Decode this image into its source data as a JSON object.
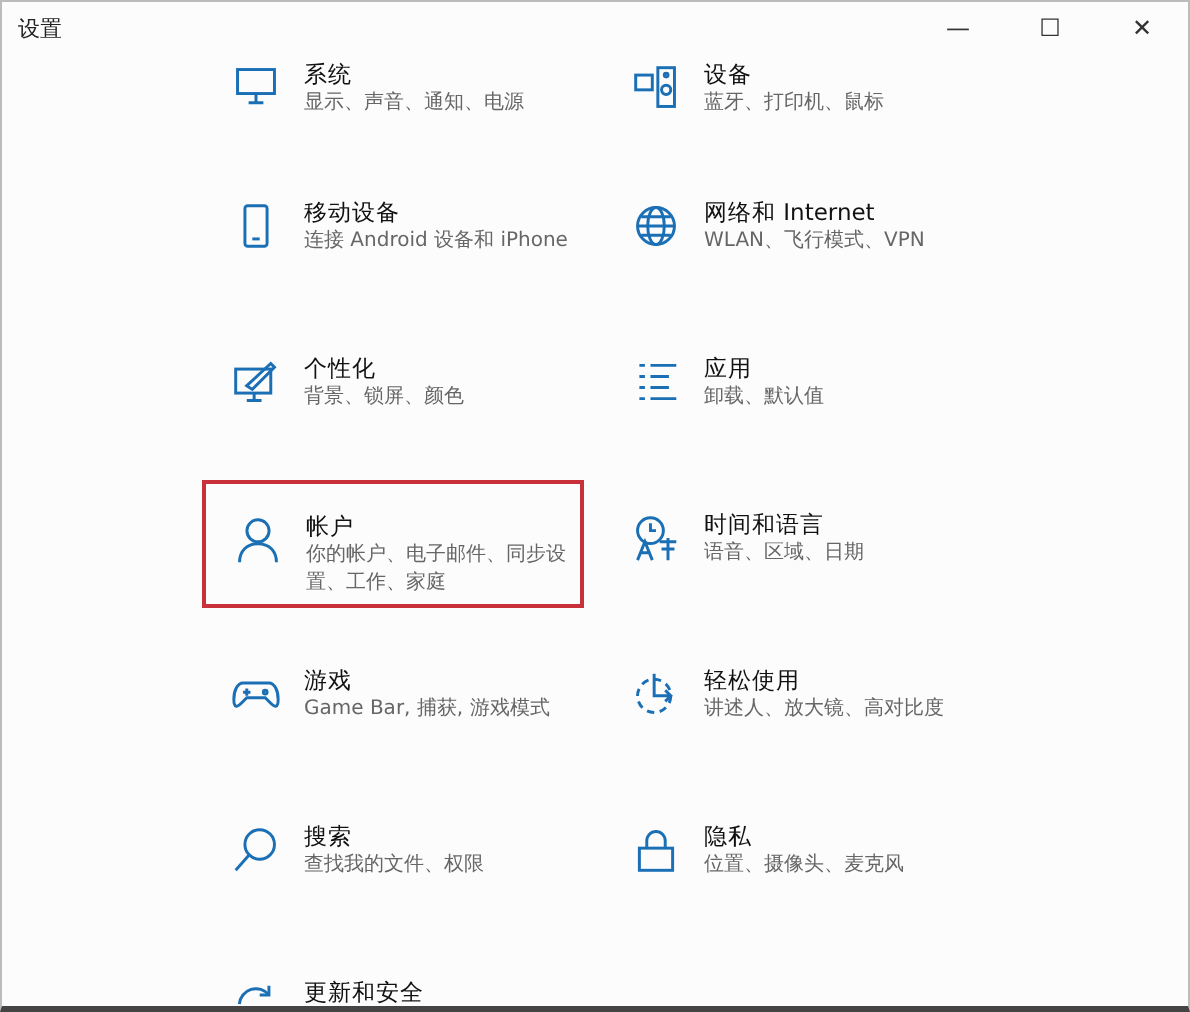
{
  "window": {
    "title": "设置",
    "controls": [
      "—",
      "☐",
      "✕"
    ]
  },
  "tiles": [
    {
      "title": "系统",
      "subtitle": "显示、声音、通知、电源",
      "selected": false
    },
    {
      "title": "设备",
      "subtitle": "蓝牙、打印机、鼠标",
      "selected": false
    },
    {
      "title": "移动设备",
      "subtitle": "连接 Android 设备和 iPhone",
      "selected": false
    },
    {
      "title": "网络和 Internet",
      "subtitle": "WLAN、飞行模式、VPN",
      "selected": false
    },
    {
      "title": "个性化",
      "subtitle": "背景、锁屏、颜色",
      "selected": false
    },
    {
      "title": "应用",
      "subtitle": "卸载、默认值",
      "selected": false
    },
    {
      "title": "帐户",
      "subtitle": "你的帐户、电子邮件、同步设置、工作、家庭",
      "selected": true
    },
    {
      "title": "时间和语言",
      "subtitle": "语音、区域、日期",
      "selected": false
    },
    {
      "title": "游戏",
      "subtitle": "Game Bar, 捕获, 游戏模式",
      "selected": false
    },
    {
      "title": "轻松使用",
      "subtitle": "讲述人、放大镜、高对比度",
      "selected": false
    },
    {
      "title": "搜索",
      "subtitle": "查找我的文件、权限",
      "selected": false
    },
    {
      "title": "隐私",
      "subtitle": "位置、摄像头、麦克风",
      "selected": false
    },
    {
      "title": "更新和安全",
      "selected": false
    }
  ]
}
